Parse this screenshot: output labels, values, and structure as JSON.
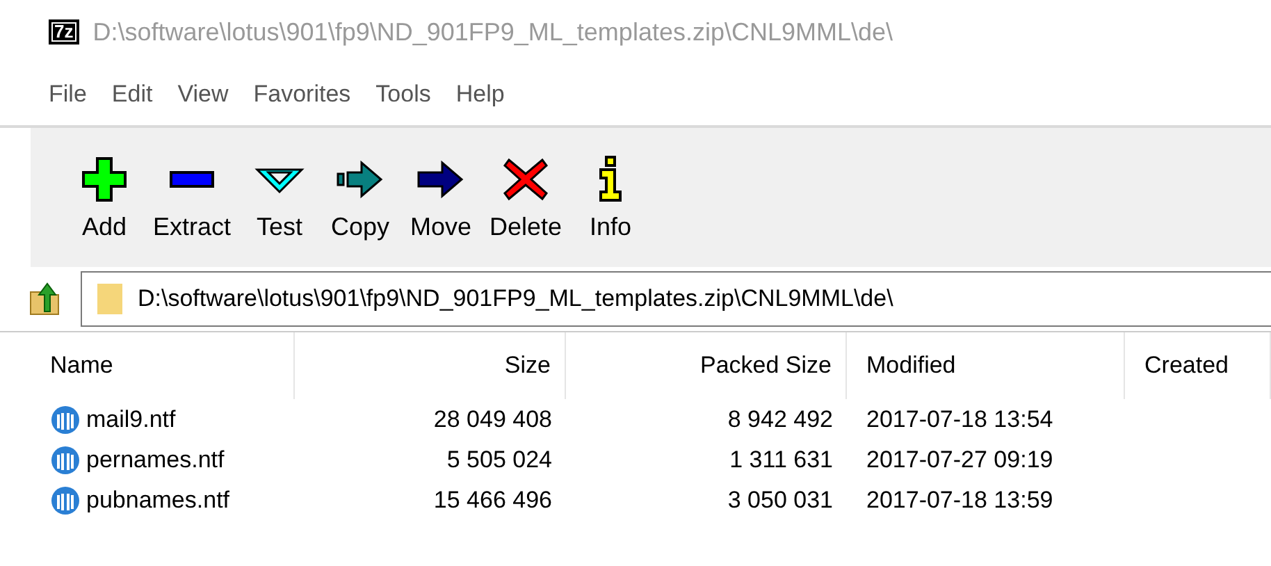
{
  "window": {
    "logo": "7z",
    "title": "D:\\software\\lotus\\901\\fp9\\ND_901FP9_ML_templates.zip\\CNL9MML\\de\\",
    "active": false
  },
  "menu": [
    "File",
    "Edit",
    "View",
    "Favorites",
    "Tools",
    "Help"
  ],
  "toolbar": [
    {
      "kind": "add",
      "label": "Add"
    },
    {
      "kind": "extract",
      "label": "Extract"
    },
    {
      "kind": "test",
      "label": "Test"
    },
    {
      "kind": "copy",
      "label": "Copy"
    },
    {
      "kind": "move",
      "label": "Move"
    },
    {
      "kind": "delete",
      "label": "Delete"
    },
    {
      "kind": "info",
      "label": "Info"
    }
  ],
  "address": {
    "value": "D:\\software\\lotus\\901\\fp9\\ND_901FP9_ML_templates.zip\\CNL9MML\\de\\"
  },
  "table": {
    "columns": [
      "Name",
      "Size",
      "Packed Size",
      "Modified",
      "Created"
    ],
    "rows": [
      {
        "name": "mail9.ntf",
        "size": "28 049 408",
        "packed": "8 942 492",
        "modified": "2017-07-18 13:54"
      },
      {
        "name": "pernames.ntf",
        "size": "5 505 024",
        "packed": "1 311 631",
        "modified": "2017-07-27 09:19"
      },
      {
        "name": "pubnames.ntf",
        "size": "15 466 496",
        "packed": "3 050 031",
        "modified": "2017-07-18 13:59"
      }
    ]
  }
}
